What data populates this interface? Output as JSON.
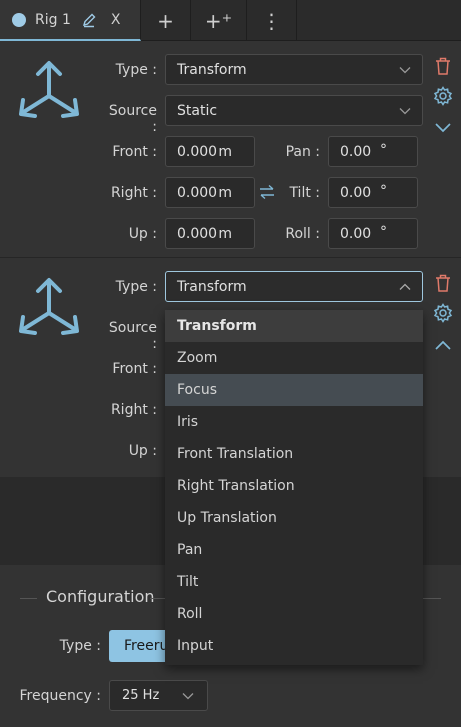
{
  "tabs": {
    "active_label": "Rig 1",
    "close_glyph": "X",
    "add_glyph": "+",
    "add_special_glyph": "+⁺",
    "menu_glyph": "⋮"
  },
  "rig1": {
    "type_label": "Type :",
    "type_value": "Transform",
    "source_label": "Source :",
    "source_value": "Static",
    "front_label": "Front :",
    "front_value": "0.000",
    "right_label": "Right :",
    "right_value": "0.000",
    "up_label": "Up :",
    "up_value": "0.000",
    "unit_m": "m",
    "pan_label": "Pan :",
    "pan_value": "0.00",
    "tilt_label": "Tilt :",
    "tilt_value": "0.00",
    "roll_label": "Roll :",
    "roll_value": "0.00",
    "unit_deg": "°"
  },
  "rig2": {
    "type_label": "Type :",
    "type_value": "Transform",
    "source_label": "Source :",
    "front_label": "Front :",
    "right_label": "Right :",
    "up_label": "Up :"
  },
  "dropdown": {
    "options": [
      "Transform",
      "Zoom",
      "Focus",
      "Iris",
      "Front Translation",
      "Right Translation",
      "Up Translation",
      "Pan",
      "Tilt",
      "Roll",
      "Input"
    ],
    "selected": "Transform",
    "hovered": "Focus"
  },
  "configuration": {
    "title": "Configuration",
    "type_label": "Type :",
    "type_button": "Freeru",
    "frequency_label": "Frequency :",
    "frequency_value": "25 Hz"
  },
  "colors": {
    "accent": "#8ec4e3",
    "delete_icon": "#e07a6a",
    "icon_blue": "#7fb8d6"
  }
}
